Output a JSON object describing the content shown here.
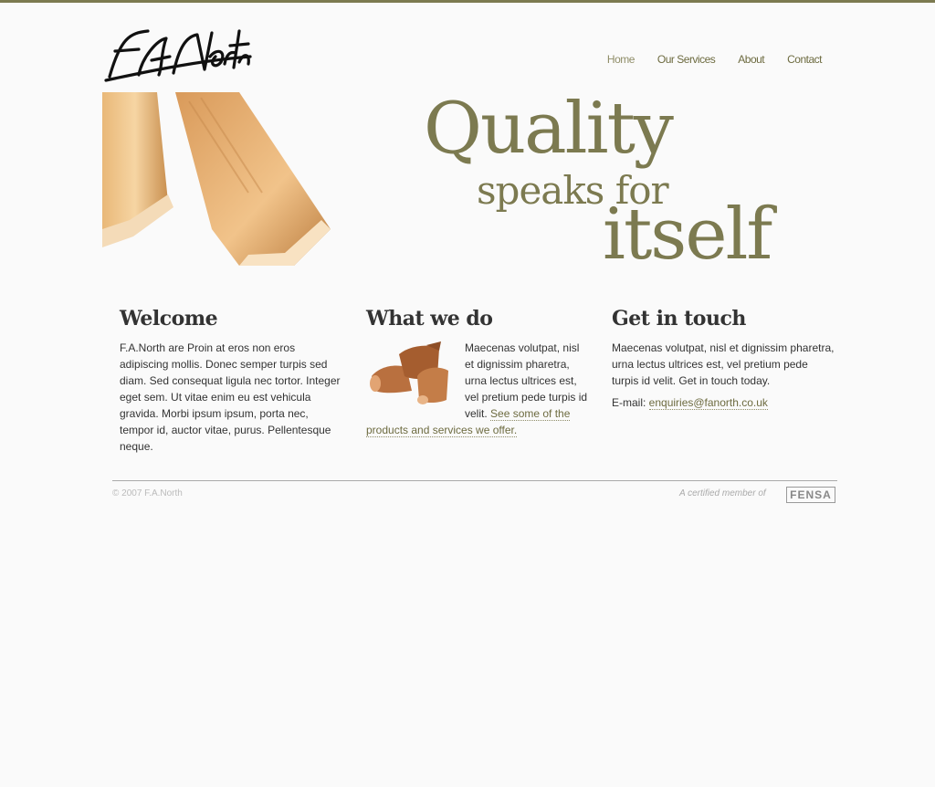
{
  "logo": {
    "text": "F.A.North"
  },
  "nav": {
    "items": [
      {
        "label": "Home"
      },
      {
        "label": "Our Services"
      },
      {
        "label": "About"
      },
      {
        "label": "Contact"
      }
    ]
  },
  "hero": {
    "tagline_line1": "Quality",
    "tagline_line2": "speaks for",
    "tagline_line3": "itself"
  },
  "welcome": {
    "heading": "Welcome",
    "body": "F.A.North are Proin at eros non eros adipiscing mollis. Donec semper turpis sed diam. Sed consequat ligula nec tortor. Integer eget sem. Ut vitae enim eu est vehicula gravida. Morbi ipsum ipsum, porta nec, tempor id, auctor vitae, purus. Pellentesque neque."
  },
  "what_we_do": {
    "heading": "What we do",
    "body": "Maecenas volutpat, nisl et dignissim pharetra, urna lectus ultrices est, vel pretium pede turpis id velit. ",
    "link": "See some of the products and services we offer."
  },
  "get_in_touch": {
    "heading": "Get in touch",
    "body": "Maecenas volutpat, nisl et dignissim pharetra, urna lectus ultrices est, vel pretium pede turpis id velit. Get in touch today.",
    "email_label": "E-mail: ",
    "email": "enquiries@fanorth.co.uk"
  },
  "footer": {
    "copyright": "© 2007 F.A.North",
    "certified": "A certified member of",
    "badge": "FENSA"
  },
  "colors": {
    "accent": "#7c7a50",
    "link": "#6d6b40",
    "text": "#333333",
    "background": "#fafafa"
  }
}
